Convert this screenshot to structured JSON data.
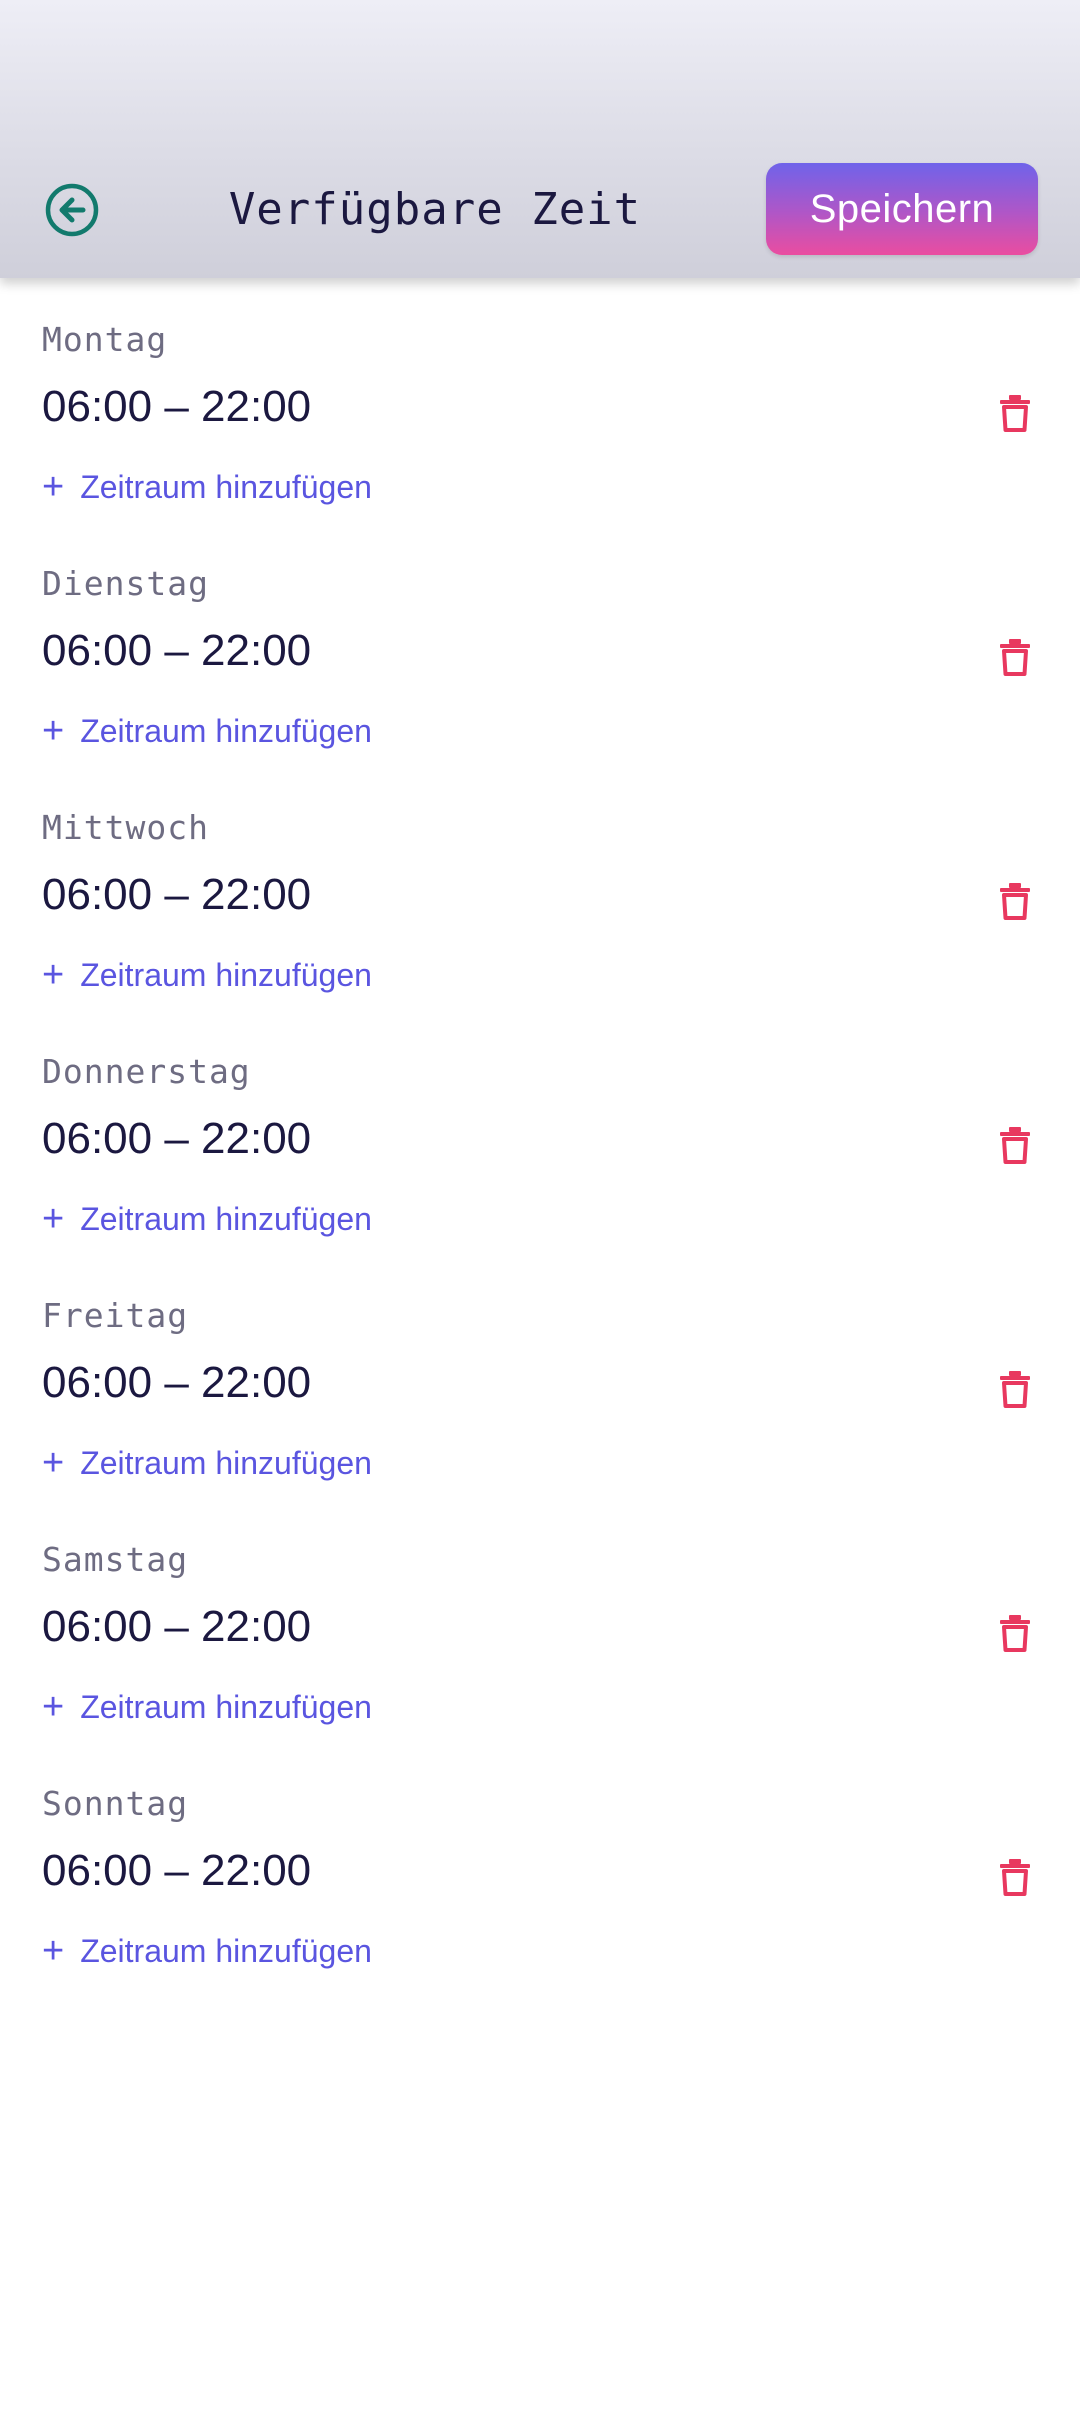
{
  "header": {
    "title": "Verfügbare Zeit",
    "save_label": "Speichern",
    "back_icon": "arrow-left-circle-icon"
  },
  "add_label": "Zeitraum hinzufügen",
  "add_symbol": "+",
  "colors": {
    "title": "#1b1840",
    "day_label": "#6e6c82",
    "accent": "#5a55e0",
    "delete": "#e8385f",
    "back_icon": "#127a6d",
    "save_gradient_top": "#6f63ea",
    "save_gradient_bottom": "#ea4da0"
  },
  "days": [
    {
      "name": "Montag",
      "range": "06:00 – 22:00"
    },
    {
      "name": "Dienstag",
      "range": "06:00 – 22:00"
    },
    {
      "name": "Mittwoch",
      "range": "06:00 – 22:00"
    },
    {
      "name": "Donnerstag",
      "range": "06:00 – 22:00"
    },
    {
      "name": "Freitag",
      "range": "06:00 – 22:00"
    },
    {
      "name": "Samstag",
      "range": "06:00 – 22:00"
    },
    {
      "name": "Sonntag",
      "range": "06:00 – 22:00"
    }
  ]
}
